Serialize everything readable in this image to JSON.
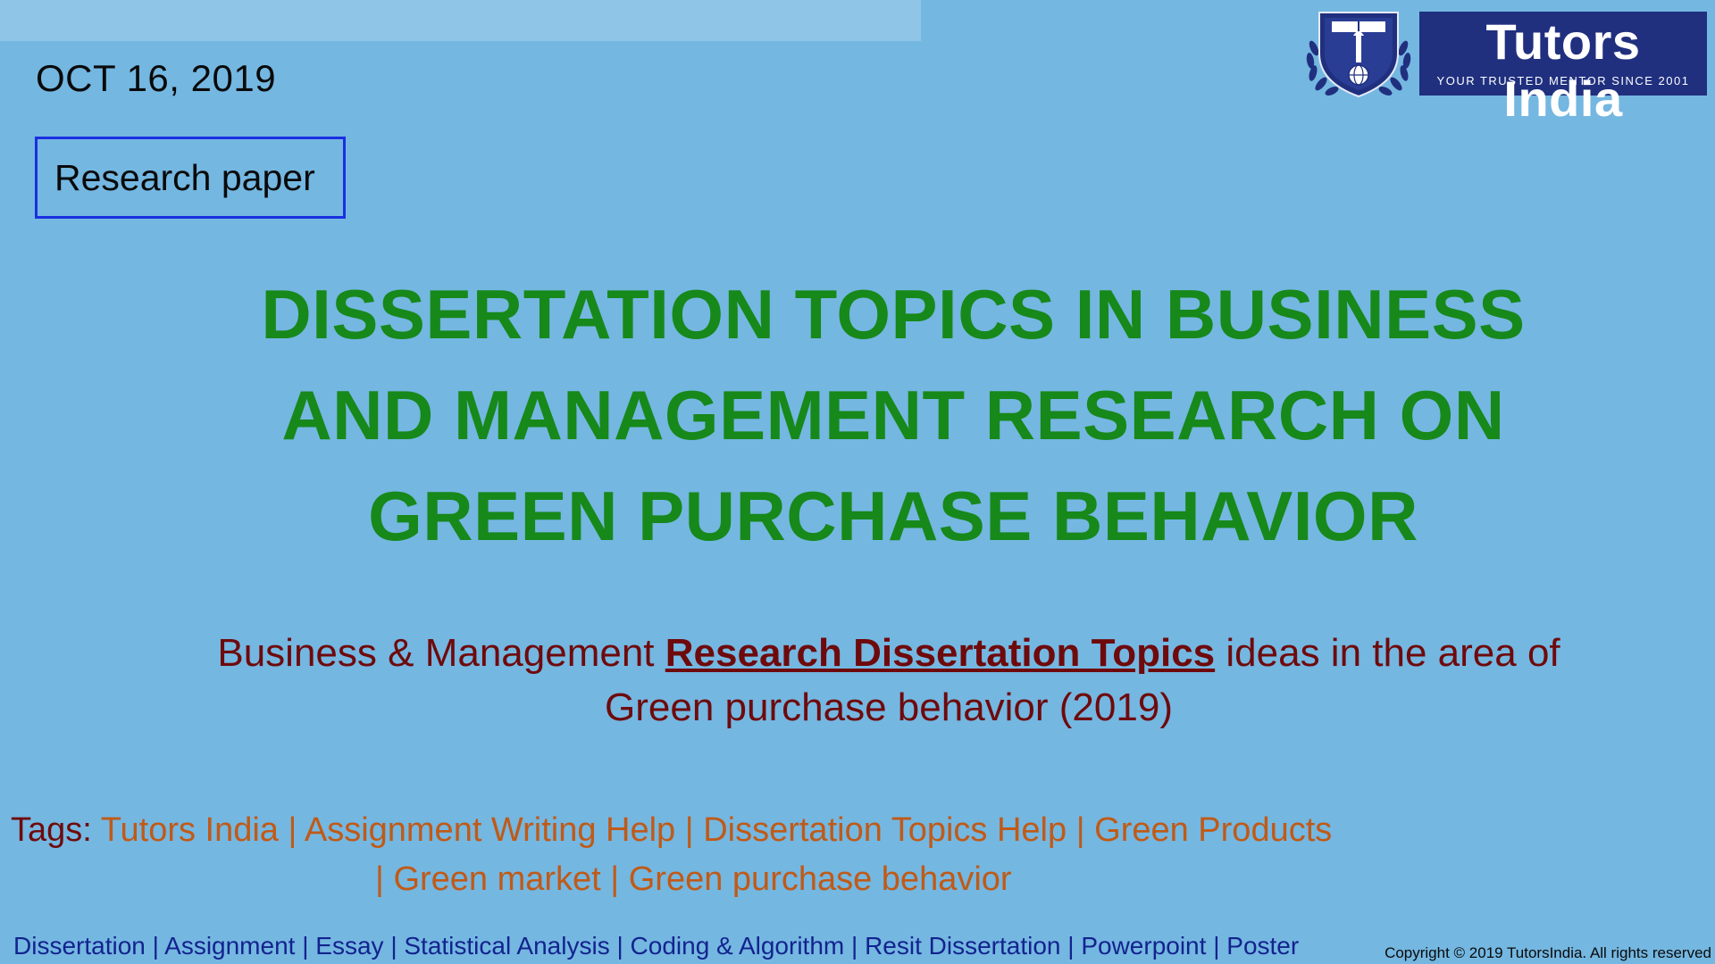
{
  "date": "OCT 16, 2019",
  "category": "Research paper",
  "title": "DISSERTATION TOPICS IN BUSINESS AND MANAGEMENT RESEARCH ON GREEN PURCHASE BEHAVIOR",
  "subtitle": {
    "prefix": "Business & Management ",
    "link": "Research Dissertation Topics",
    "suffix": " ideas in the area of Green purchase behavior (2019)"
  },
  "tags": {
    "label": "Tags: ",
    "items": [
      "Tutors India",
      "Assignment Writing Help",
      "Dissertation Topics Help",
      "Green Products",
      "Green market",
      "Green purchase behavior"
    ]
  },
  "footer_nav": [
    "Dissertation",
    "Assignment",
    "Essay",
    "Statistical Analysis",
    "Coding & Algorithm ",
    "Resit Dissertation",
    "Powerpoint",
    "Poster"
  ],
  "copyright": "Copyright © 2019 TutorsIndia. All rights reserved",
  "logo": {
    "name": "Tutors India",
    "tagline": "YOUR TRUSTED MENTOR SINCE 2001"
  },
  "colors": {
    "background": "#74b7e1",
    "title": "#17881a",
    "subtitle": "#6e0a0c",
    "tag": "#c05a17",
    "footer_link": "#13238e",
    "category_border": "#1a2fe0",
    "brand": "#20307f"
  }
}
